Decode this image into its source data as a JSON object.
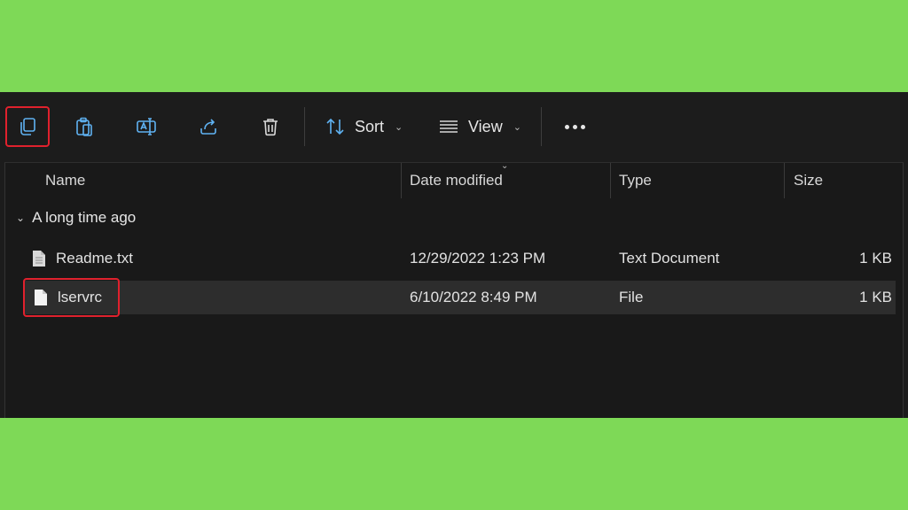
{
  "toolbar": {
    "copy_icon": "copy-icon",
    "paste_icon": "paste-icon",
    "rename_icon": "rename-icon",
    "share_icon": "share-icon",
    "delete_icon": "trash-icon",
    "sort_label": "Sort",
    "view_label": "View",
    "more_icon": "more-icon"
  },
  "columns": {
    "name": "Name",
    "date": "Date modified",
    "type": "Type",
    "size": "Size"
  },
  "group": {
    "label": "A long time ago"
  },
  "files": [
    {
      "name": "Readme.txt",
      "date": "12/29/2022 1:23 PM",
      "type": "Text Document",
      "size": "1 KB",
      "selected": false
    },
    {
      "name": "lservrc",
      "date": "6/10/2022 8:49 PM",
      "type": "File",
      "size": "1 KB",
      "selected": true
    }
  ],
  "colors": {
    "background": "#7ed957",
    "window": "#1c1c1c",
    "highlight": "#e0212d",
    "accent": "#5fb2f2"
  }
}
